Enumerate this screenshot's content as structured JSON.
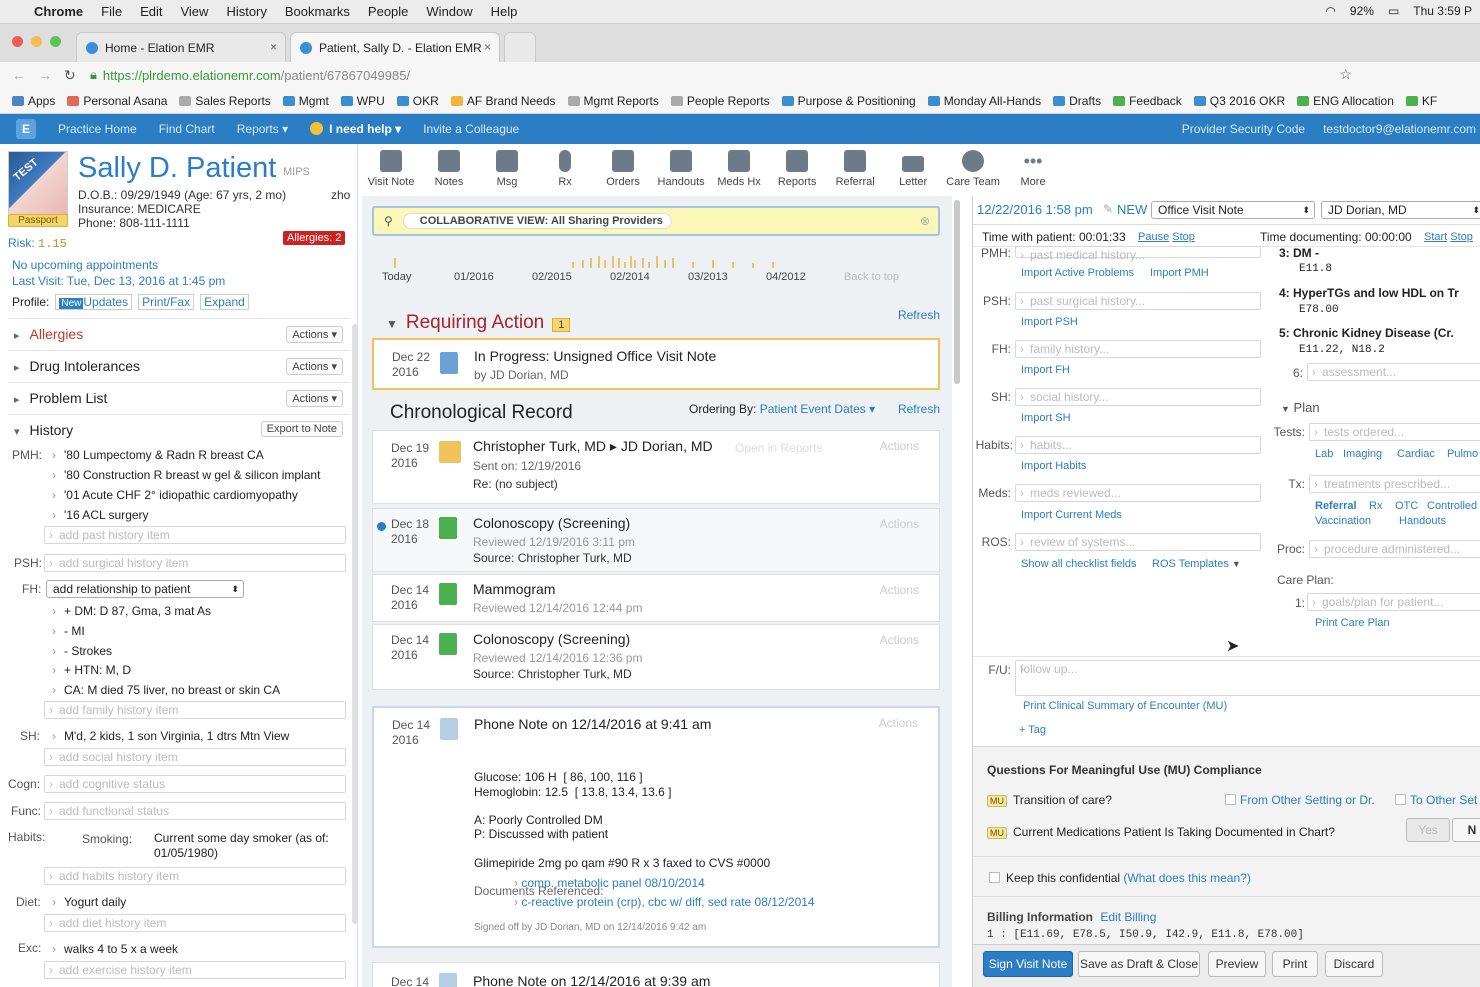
{
  "mac": {
    "app": "Chrome",
    "menus": [
      "File",
      "Edit",
      "View",
      "History",
      "Bookmarks",
      "People",
      "Window",
      "Help"
    ],
    "battery": "92%",
    "clock": "Thu 3:59 P"
  },
  "tabs": [
    {
      "label": "Home - Elation EMR"
    },
    {
      "label": "Patient, Sally D. - Elation EMR"
    }
  ],
  "url": {
    "host": "https://plrdemo.elationemr.com",
    "path": "/patient/67867049985/"
  },
  "bookmarks": [
    "Apps",
    "Personal Asana",
    "Sales Reports",
    "Mgmt",
    "WPU",
    "OKR",
    "AF Brand Needs",
    "Mgmt Reports",
    "People Reports",
    "Purpose & Positioning",
    "Monday All-Hands",
    "Drafts",
    "Feedback",
    "Q3 2016 OKR",
    "ENG Allocation",
    "KF"
  ],
  "appnav": {
    "items": [
      "Practice Home",
      "Find Chart",
      "Reports ▾",
      "I need help ▾",
      "Invite a Colleague"
    ],
    "right": [
      "Provider Security Code",
      "testdoctor9@elationemr.com"
    ]
  },
  "patient": {
    "name": "Sally D. Patient",
    "mips": "MIPS",
    "dob": "D.O.B.: 09/29/1949 (Age: 67 yrs, 2 mo)",
    "lang": "zho",
    "insurance": "Insurance:  MEDICARE",
    "phone": "Phone: 808-111-1111",
    "passport": "Passport",
    "risk_label": "Risk:",
    "risk_val": "1.15",
    "allergies": "Allergies: 2",
    "appt": "No upcoming appointments",
    "last_visit": "Last Visit: Tue, Dec 13, 2016 at 1:45 pm",
    "profile": "Profile:",
    "new": "New",
    "updates": "Updates",
    "print": "Print/Fax",
    "expand": "Expand"
  },
  "sections": {
    "allergies": "Allergies",
    "drug": "Drug Intolerances",
    "problem": "Problem List",
    "history": "History",
    "actions": "Actions ▾",
    "export": "Export to Note"
  },
  "history": {
    "pmh_label": "PMH:",
    "pmh": [
      "'80 Lumpectomy & Radn R breast CA",
      "'80 Construction R breast w gel & silicon implant",
      "'01 Acute CHF 2° idiopathic cardiomyopathy",
      "'16 ACL surgery"
    ],
    "pmh_add": "add past history item",
    "psh_label": "PSH:",
    "psh_add": "add surgical history item",
    "fh_label": "FH:",
    "fh_select": "add relationship to patient",
    "fh": [
      "+ DM: D 87, Gma, 3 mat As",
      "- MI",
      "- Strokes",
      "+ HTN: M, D",
      "CA: M died 75 liver, no breast or skin CA"
    ],
    "fh_add": "add family history item",
    "sh_label": "SH:",
    "sh": "M'd, 2 kids, 1 son Virginia, 1 dtrs Mtn View",
    "sh_add": "add social history item",
    "cogn_label": "Cogn:",
    "cogn_add": "add cognitive status",
    "func_label": "Func:",
    "func_add": "add functional status",
    "habits_label": "Habits:",
    "smoking": "Smoking:",
    "smoking_val": "Current some day smoker (as of: 01/05/1980)",
    "habits_add": "add habits history item",
    "diet_label": "Diet:",
    "diet": "Yogurt daily",
    "diet_add": "add diet history item",
    "exc_label": "Exc:",
    "exc": "walks 4 to 5 x a week",
    "exc_add": "add exercise history item"
  },
  "toolbar": [
    "Visit Note",
    "Notes",
    "Msg",
    "Rx",
    "Orders",
    "Handouts",
    "Meds Hx",
    "Reports",
    "Referral",
    "Letter",
    "Care Team",
    "More"
  ],
  "collab": "COLLABORATIVE VIEW: All Sharing Providers",
  "timeline": {
    "labels": [
      "Today",
      "01/2016",
      "02/2015",
      "02/2014",
      "03/2013",
      "04/2012"
    ],
    "back": "Back to top"
  },
  "requiring": {
    "title": "Requiring Action",
    "count": "1",
    "refresh": "Refresh",
    "date": "Dec 22",
    "year": "2016",
    "item": "In Progress: Unsigned Office Visit Note",
    "by": "by JD Dorian, MD"
  },
  "chrono": {
    "title": "Chronological Record",
    "ordering": "Ordering By:",
    "order_val": "Patient Event Dates ▾",
    "refresh": "Refresh"
  },
  "records": [
    {
      "date": "Dec 19",
      "year": "2016",
      "title": "Christopher Turk, MD ▸ JD Dorian, MD",
      "open": "Open in Reports",
      "l1": "Sent on: 12/19/2016",
      "l2": "Re: (no subject)",
      "actions": "Actions"
    },
    {
      "date": "Dec 18",
      "year": "2016",
      "title": "Colonoscopy (Screening)",
      "l1": "Reviewed 12/19/2016 3:11 pm",
      "l2": "Source: Christopher Turk, MD",
      "actions": "Actions"
    },
    {
      "date": "Dec 14",
      "year": "2016",
      "title": "Mammogram",
      "l1": "Reviewed 12/14/2016 12:44 pm",
      "actions": "Actions"
    },
    {
      "date": "Dec 14",
      "year": "2016",
      "title": "Colonoscopy (Screening)",
      "l1": "Reviewed 12/14/2016 12:36 pm",
      "l2": "Source: Christopher Turk, MD",
      "actions": "Actions"
    }
  ],
  "phone": {
    "date": "Dec 14",
    "year": "2016",
    "title": "Phone Note on 12/14/2016 at 9:41 am",
    "actions": "Actions",
    "lines": [
      "Glucose: 106 H  [ 86, 100, 116 ]",
      "Hemoglobin: 12.5  [ 13.8, 13.4, 13.6 ]",
      "",
      "A: Poorly Controlled DM",
      "P: Discussed with patient",
      "",
      "Glimepiride 2mg po qam #90 R x 3 faxed to CVS #0000",
      "",
      "Documents Referenced:"
    ],
    "docs": [
      "comp. metabolic panel 08/10/2014",
      "c-reactive protein (crp), cbc w/ diff, sed rate 08/12/2014"
    ],
    "signed": "Signed off by JD Dorian, MD on 12/14/2016 9:42 am",
    "next": "Phone Note on 12/14/2016 at 9:39 am",
    "next_date": "Dec 14"
  },
  "note": {
    "datetime": "12/22/2016 1:58 pm",
    "new": "NEW",
    "type": "Office Visit Note",
    "provider": "JD Dorian, MD",
    "twp": "Time with patient:",
    "twp_val": "00:01:33",
    "pause": "Pause",
    "stop": "Stop",
    "tdoc": "Time documenting:",
    "tdoc_val": "00:00:00",
    "start": "Start",
    "stop2": "Stop",
    "pmh": "PMH:",
    "pmh_ph": "past medical history...",
    "imp_ap": "Import Active Problems",
    "imp_pmh": "Import PMH",
    "psh": "PSH:",
    "psh_ph": "past surgical history...",
    "imp_psh": "Import PSH",
    "fh": "FH:",
    "fh_ph": "family history...",
    "imp_fh": "Import FH",
    "sh": "SH:",
    "sh_ph": "social history...",
    "imp_sh": "Import SH",
    "habits": "Habits:",
    "habits_ph": "habits...",
    "imp_habits": "Import Habits",
    "meds": "Meds:",
    "meds_ph": "meds reviewed...",
    "imp_meds": "Import Current Meds",
    "ros": "ROS:",
    "ros_ph": "review of systems...",
    "show_all": "Show all checklist fields",
    "ros_tpl": "ROS Templates",
    "fu": "F/U:",
    "fu_ph": "follow up...",
    "print_summary": "Print Clinical Summary of Encounter (MU)",
    "tag": "+ Tag",
    "dx3": "3:  DM -",
    "dx3c": "E11.8",
    "dx4": "4:  HyperTGs and low HDL on Tr",
    "dx4c": "E78.00",
    "dx5": "5:  Chronic Kidney Disease (Cr.",
    "dx5c": "E11.22, N18.2",
    "dx6": "6:",
    "dx6_ph": "assessment...",
    "plan": "Plan",
    "tests": "Tests:",
    "tests_ph": "tests ordered...",
    "tlinks": [
      "Lab",
      "Imaging",
      "Cardiac",
      "Pulmo"
    ],
    "tx": "Tx:",
    "tx_ph": "treatments prescribed...",
    "txlinks": [
      "Referral",
      "Rx",
      "OTC",
      "Controlled"
    ],
    "txlinks2": [
      "Vaccination",
      "Handouts"
    ],
    "proc": "Proc:",
    "proc_ph": "procedure administered...",
    "care": "Care Plan:",
    "care1": "1:",
    "care_ph": "goals/plan for patient...",
    "print_care": "Print Care Plan"
  },
  "mu": {
    "title": "Questions For Meaningful Use (MU) Compliance",
    "badge": "MU",
    "q1": "Transition of care?",
    "from": "From Other Setting or Dr.",
    "to": "To Other Set",
    "q2": "Current Medications Patient Is Taking Documented in Chart?",
    "yes": "Yes",
    "no": "N"
  },
  "confidential": "Keep this confidential",
  "what": "(What does this mean?)",
  "billing": {
    "title": "Billing Information",
    "edit": "Edit Billing",
    "codes": "1 : [E11.69, E78.5, I50.9, I42.9, E11.8, E78.00]"
  },
  "buttons": [
    "Sign Visit Note",
    "Save as Draft & Close",
    "Preview",
    "Print",
    "Discard"
  ]
}
